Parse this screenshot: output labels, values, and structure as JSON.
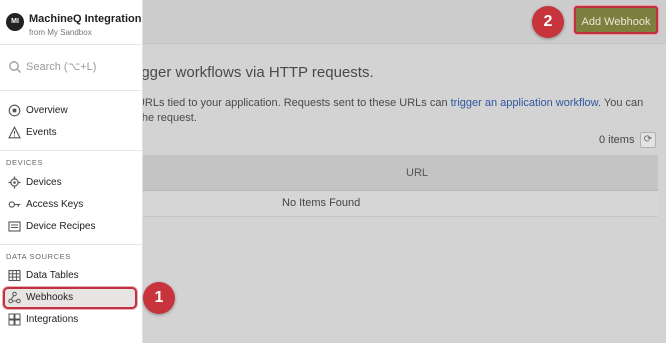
{
  "org": {
    "logo": "MI",
    "name": "MachineQ Integration",
    "subtitle": "from My Sandbox"
  },
  "search": {
    "placeholder": "Search (⌥+L)"
  },
  "nav": {
    "overview": "Overview",
    "events": "Events",
    "devices_section": "DEVICES",
    "devices": "Devices",
    "access_keys": "Access Keys",
    "device_recipes": "Device Recipes",
    "data_sources_section": "DATA SOURCES",
    "data_tables": "Data Tables",
    "webhooks": "Webhooks",
    "integrations": "Integrations"
  },
  "header": {
    "add_button": "Add Webhook"
  },
  "badges": {
    "one": "1",
    "two": "2"
  },
  "content": {
    "headline": "rigger workflows via HTTP requests.",
    "desc_prefix": "ed) URLs tied to your application. Requests sent to these URLs can ",
    "desc_link": "trigger an application workflow",
    "desc_middle": ". You can",
    "desc_line2": "y to the request.",
    "items_count": "0 items",
    "column_url": "URL",
    "empty_message": "No Items Found"
  },
  "colors": {
    "accent_button": "#7c7f3d",
    "highlight": "#c0303f",
    "badge": "#c8343c",
    "link": "#2e57a0"
  },
  "icons": {
    "overview": "overview-icon",
    "events": "warning-triangle-icon",
    "devices": "gear-icon",
    "access_keys": "key-icon",
    "device_recipes": "recipe-icon",
    "data_tables": "table-icon",
    "webhooks": "webhook-icon",
    "integrations": "integrations-icon",
    "search": "search-icon",
    "refresh": "refresh-icon"
  }
}
